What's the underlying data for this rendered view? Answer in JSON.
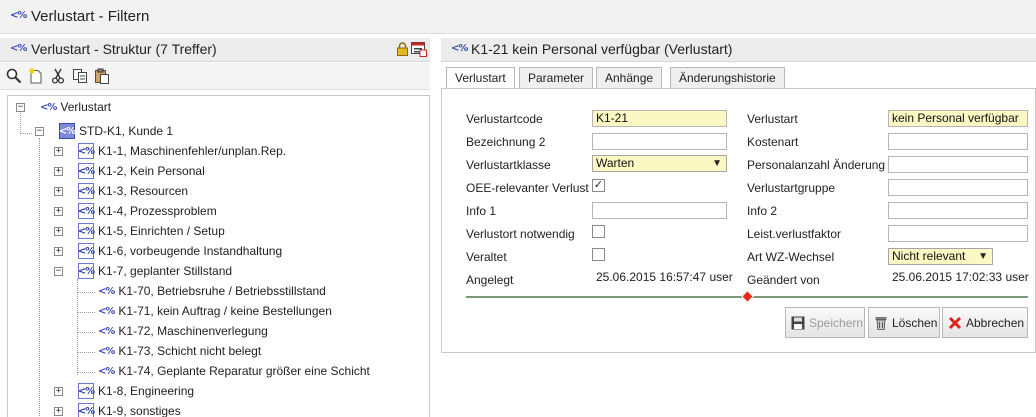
{
  "window": {
    "title": "Verlustart - Filtern"
  },
  "left": {
    "header_title": "Verlustart - Struktur (7 Treffer)"
  },
  "icons": {
    "pct_glyph": "<%",
    "toolbar": [
      "search-icon",
      "new-item-icon",
      "cut-icon",
      "copy-icon",
      "paste-icon"
    ]
  },
  "tree": {
    "root": "Verlustart",
    "std": "STD-K1, Kunde 1",
    "items": [
      "K1-1, Maschinenfehler/unplan.Rep.",
      "K1-2, Kein Personal",
      "K1-3, Resourcen",
      "K1-4, Prozessproblem",
      "K1-5, Einrichten / Setup",
      "K1-6, vorbeugende Instandhaltung",
      "K1-7, geplanter Stillstand"
    ],
    "children": [
      "K1-70, Betriebsruhe / Betriebsstillstand",
      "K1-71, kein Auftrag / keine Bestellungen",
      "K1-72, Maschinenverlegung",
      "K1-73, Schicht nicht belegt",
      "K1-74, Geplante Reparatur größer eine Schicht"
    ],
    "after": [
      "K1-8, Engineering",
      "K1-9, sonstiges"
    ]
  },
  "right": {
    "header_title": "K1-21 kein Personal verfügbar (Verlustart)",
    "tabs": [
      "Verlustart",
      "Parameter",
      "Anhänge",
      "Änderungshistorie"
    ],
    "form": {
      "labels_left": [
        "Verlustartcode",
        "Bezeichnung 2",
        "Verlustartklasse",
        "OEE-relevanter Verlust",
        "Info 1",
        "Verlustort notwendig",
        "Veraltet",
        "Angelegt"
      ],
      "labels_right": [
        "Verlustart",
        "Kostenart",
        "Personalanzahl Änderung",
        "Verlustartgruppe",
        "Info 2",
        "Leist.verlustfaktor",
        "Art WZ-Wechsel",
        "Geändert von"
      ],
      "verlustartcode": "K1-21",
      "verlustart": "kein Personal verfügbar",
      "verlustartklasse": "Warten",
      "art_wz_wechsel": "Nicht relevant",
      "oee_checked": "✓",
      "angelegt": "25.06.2015 16:57:47 user",
      "geaendert_von": "25.06.2015 17:02:33 user"
    },
    "buttons": {
      "save": "Speichern",
      "delete": "Löschen",
      "cancel": "Abbrechen"
    }
  },
  "colors": {
    "required_field": "#fbf8c4",
    "icon_blue": "#3a4bb0",
    "splitter_marker": "#e32a1a"
  }
}
